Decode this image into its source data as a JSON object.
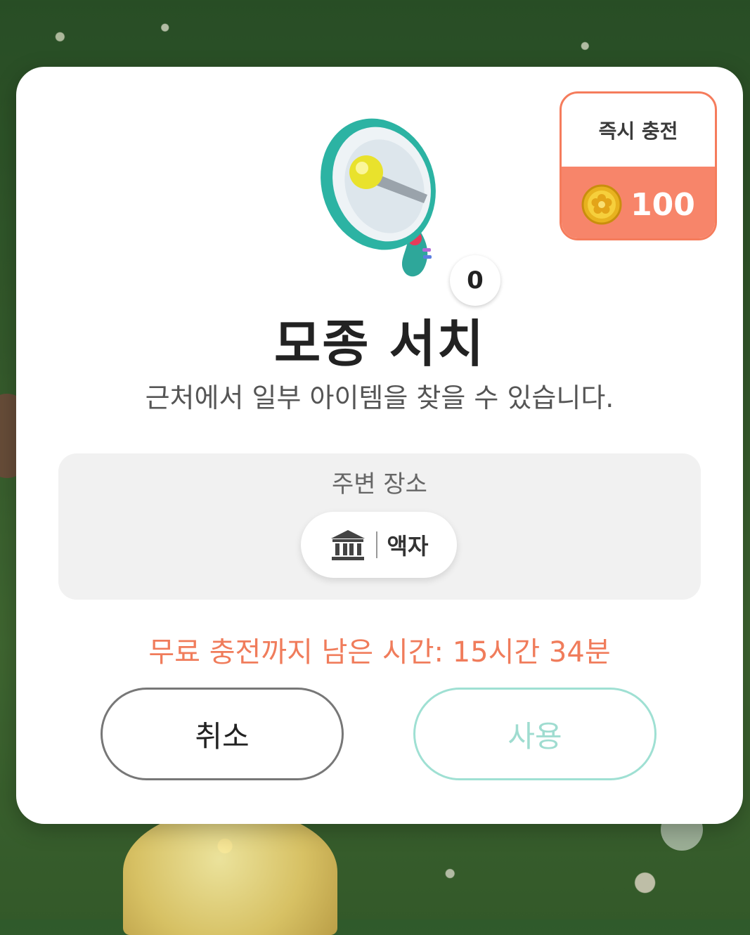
{
  "item": {
    "name": "모종 서치",
    "description": "근처에서 일부 아이템을 찾을 수 있습니다.",
    "count": "0",
    "icon": "megaphone-icon"
  },
  "recharge": {
    "label": "즉시 충전",
    "price": "100",
    "currency_icon": "coin-icon",
    "accent_color": "#f7856a"
  },
  "places": {
    "label": "주변 장소",
    "items": [
      {
        "icon": "museum-icon",
        "name": "액자"
      }
    ]
  },
  "timer_text": "무료 충전까지 남은 시간: 15시간 34분",
  "buttons": {
    "cancel": "취소",
    "use": "사용"
  }
}
